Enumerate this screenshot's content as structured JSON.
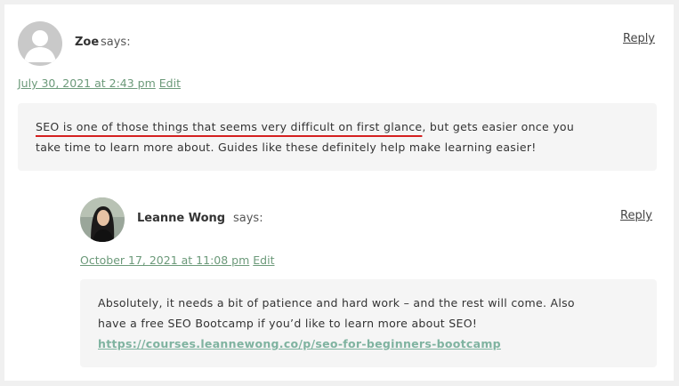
{
  "comments": [
    {
      "author": "Zoe",
      "says": "says:",
      "reply": "Reply",
      "date": "July 30, 2021 at 2:43 pm",
      "edit": "Edit",
      "text_highlight": "SEO is one of those things that seems very difficult on first glance",
      "text_rest_line1": ", but gets easier once you",
      "text_line2": "take time to learn more about. Guides like these definitely help make learning easier!"
    },
    {
      "author": "Leanne Wong",
      "says": "says:",
      "reply": "Reply",
      "date": "October 17, 2021 at 11:08 pm",
      "edit": "Edit",
      "text_line1": "Absolutely, it needs a bit of patience and hard work – and the rest will come. Also",
      "text_line2": "have a free SEO Bootcamp if you’d like to learn more about SEO!",
      "link": "https://courses.leannewong.co/p/seo-for-beginners-bootcamp"
    }
  ],
  "colors": {
    "link_meta": "#6c9a7a",
    "link_comment": "#7fb3a0",
    "highlight_underline": "#d42020",
    "comment_bg": "#f5f5f5"
  },
  "icons": {
    "zoe_avatar": "default-person-avatar",
    "leanne_avatar": "profile-photo-avatar"
  }
}
